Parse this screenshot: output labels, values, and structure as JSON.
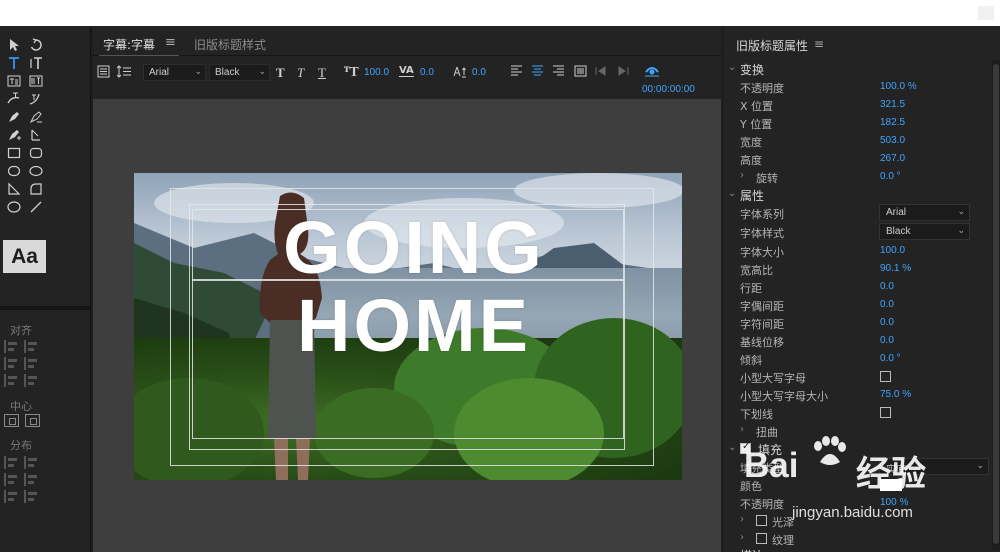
{
  "title_panel": {
    "tab_active": "字幕:字幕",
    "tab_inactive": "旧版标题样式",
    "font_family": "Arial",
    "font_style": "Black",
    "font_size": "100.0",
    "kerning": "0.0",
    "baseline": "0.0",
    "timecode": "00:00:00:00",
    "title_line1": "GOING",
    "title_line2": "HOME"
  },
  "tools": {
    "aa_label": "Aa",
    "align_label": "对齐",
    "center_label": "中心",
    "distribute_label": "分布"
  },
  "props": {
    "title": "旧版标题属性",
    "transform": "变换",
    "opacity_label": "不透明度",
    "opacity": "100.0 %",
    "x_label": "X 位置",
    "x": "321.5",
    "y_label": "Y 位置",
    "y": "182.5",
    "width_label": "宽度",
    "width": "503.0",
    "height_label": "高度",
    "height": "267.0",
    "rotate_label": "旋转",
    "rotate": "0.0 °",
    "attributes": "属性",
    "font_family_label": "字体系列",
    "font_family": "Arial",
    "font_style_label": "字体样式",
    "font_style": "Black",
    "font_size_label": "字体大小",
    "font_size": "100.0",
    "aspect_label": "宽高比",
    "aspect": "90.1 %",
    "leading_label": "行距",
    "leading": "0.0",
    "kerning_label": "字偶间距",
    "kerning": "0.0",
    "tracking_label": "字符间距",
    "tracking": "0.0",
    "baseline_label": "基线位移",
    "baseline": "0.0",
    "slant_label": "倾斜",
    "slant": "0.0 °",
    "small_caps_label": "小型大写字母",
    "small_caps_size_label": "小型大写字母大小",
    "small_caps_size": "75.0 %",
    "underline_label": "下划线",
    "distort_label": "扭曲",
    "fill": "填充",
    "fill_type_label": "填充类型",
    "fill_type": "实底",
    "color_label": "颜色",
    "fill_opacity_label": "不透明度",
    "fill_opacity": "100 %",
    "sheen_label": "光泽",
    "texture_label": "纹理",
    "stroke_label": "描边"
  },
  "watermark": {
    "brand": "Bai",
    "brand2": "经验",
    "url": "jingyan.baidu.com"
  }
}
